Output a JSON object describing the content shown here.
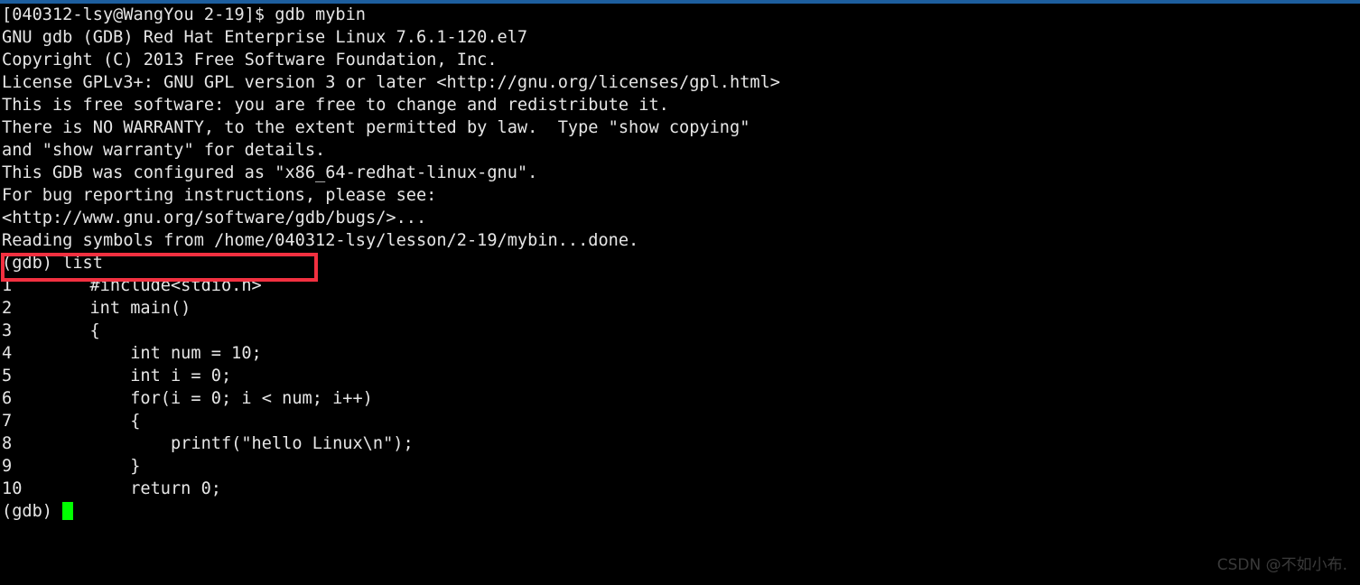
{
  "terminal": {
    "background_color": "#000000",
    "text_color": "#e6e6e6",
    "top_edge_color": "#1d5e9e",
    "cursor_color": "#00ff00",
    "highlight_color": "#f23040",
    "shell_lines": [
      "[040312-lsy@WangYou 2-19]$ gdb mybin",
      "GNU gdb (GDB) Red Hat Enterprise Linux 7.6.1-120.el7",
      "Copyright (C) 2013 Free Software Foundation, Inc.",
      "License GPLv3+: GNU GPL version 3 or later <http://gnu.org/licenses/gpl.html>",
      "This is free software: you are free to change and redistribute it.",
      "There is NO WARRANTY, to the extent permitted by law.  Type \"show copying\"",
      "and \"show warranty\" for details.",
      "This GDB was configured as \"x86_64-redhat-linux-gnu\".",
      "For bug reporting instructions, please see:",
      "<http://www.gnu.org/software/gdb/bugs/>...",
      "Reading symbols from /home/040312-lsy/lesson/2-19/mybin...done."
    ],
    "gdb_command_line": "(gdb) list",
    "code_listing": [
      {
        "number": "1",
        "text": "#include<stdio.h>"
      },
      {
        "number": "2",
        "text": "int main()"
      },
      {
        "number": "3",
        "text": "{"
      },
      {
        "number": "4",
        "text": "    int num = 10;"
      },
      {
        "number": "5",
        "text": "    int i = 0;"
      },
      {
        "number": "6",
        "text": "    for(i = 0; i < num; i++)"
      },
      {
        "number": "7",
        "text": "    {"
      },
      {
        "number": "8",
        "text": "        printf(\"hello Linux\\n\");"
      },
      {
        "number": "9",
        "text": "    }"
      },
      {
        "number": "10",
        "text": "    return 0;"
      }
    ],
    "final_prompt": "(gdb) "
  },
  "watermark": {
    "text": "CSDN @不如小布."
  }
}
